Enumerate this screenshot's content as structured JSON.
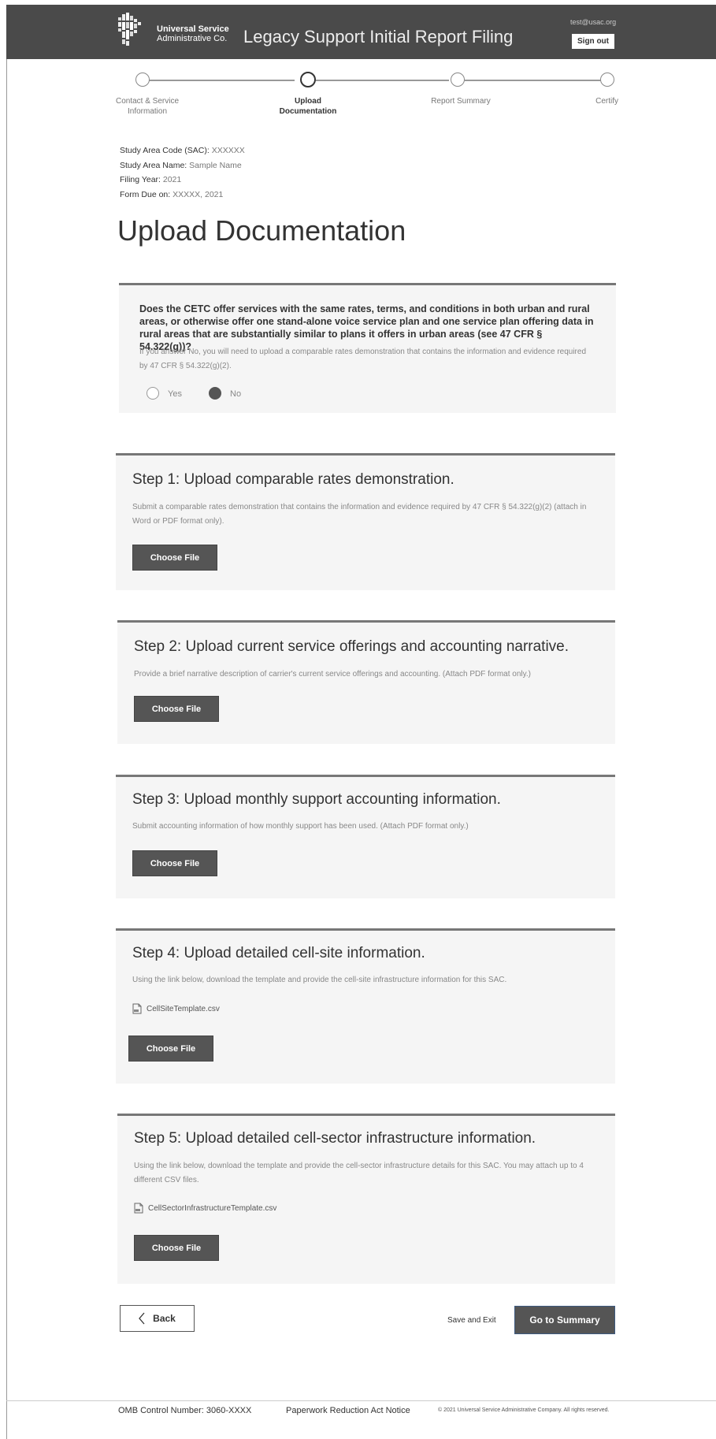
{
  "header": {
    "org_line1": "Universal Service",
    "org_line2": "Administrative Co.",
    "app_title": "Legacy Support Initial Report Filing",
    "user_email": "test@usac.org",
    "sign_out": "Sign out"
  },
  "stepper": {
    "steps": [
      {
        "label": "Contact & Service Information",
        "state": "incomplete"
      },
      {
        "label": "Upload Documentation",
        "state": "current"
      },
      {
        "label": "Report Summary",
        "state": "incomplete"
      },
      {
        "label": "Certify",
        "state": "incomplete"
      }
    ]
  },
  "meta": {
    "sac_label": "Study Area Code (SAC):",
    "sac_value": "XXXXXX",
    "name_label": "Study Area Name:",
    "name_value": "Sample Name",
    "year_label": "Filing Year:",
    "year_value": "2021",
    "due_label": "Form Due on:",
    "due_value": "XXXXX, 2021"
  },
  "page_title": "Upload Documentation",
  "question": {
    "text": "Does the CETC offer services with the same rates, terms, and conditions in both urban and rural areas, or otherwise offer one stand-alone voice service plan and one service plan offering data in rural areas that are substantially similar to plans it offers in urban areas (see 47 CFR § 54.322(g))?",
    "help": "If you answer No, you will need to upload a comparable rates demonstration that contains the information and evidence required by 47 CFR § 54.322(g)(2).",
    "options": [
      "Yes",
      "No"
    ],
    "selected": "No"
  },
  "steps": [
    {
      "title": "Step 1: Upload comparable rates demonstration.",
      "desc": "Submit a comparable rates demonstration that contains the information and evidence required by 47 CFR § 54.322(g)(2) (attach in Word or PDF format only).",
      "button": "Choose File"
    },
    {
      "title": "Step 2: Upload current service offerings and accounting narrative.",
      "desc": "Provide a brief narrative description of carrier's current service offerings and accounting. (Attach PDF format only.)",
      "button": "Choose File"
    },
    {
      "title": "Step 3: Upload monthly support accounting information.",
      "desc": "Submit accounting information of how monthly support has been used. (Attach PDF format only.)",
      "button": "Choose File"
    },
    {
      "title": "Step 4: Upload detailed cell-site information.",
      "desc": "Using the link below, download the template and provide the cell-site infrastructure information for this SAC.",
      "file": "CellSiteTemplate.csv",
      "button": "Choose File"
    },
    {
      "title": "Step 5: Upload detailed cell-sector infrastructure information.",
      "desc": "Using the link below, download the template and provide the cell-sector infrastructure details for this SAC. You may attach up to 4 different CSV files.",
      "file": "CellSectorInfrastructureTemplate.csv",
      "button": "Choose File"
    }
  ],
  "actions": {
    "back": "Back",
    "save_exit": "Save and Exit",
    "go_summary": "Go to Summary"
  },
  "footer": {
    "omb": "OMB Control Number: 3060-XXXX",
    "paperwork": "Paperwork Reduction Act Notice",
    "copyright": "© 2021 Universal Service Administrative Company. All rights reserved."
  }
}
